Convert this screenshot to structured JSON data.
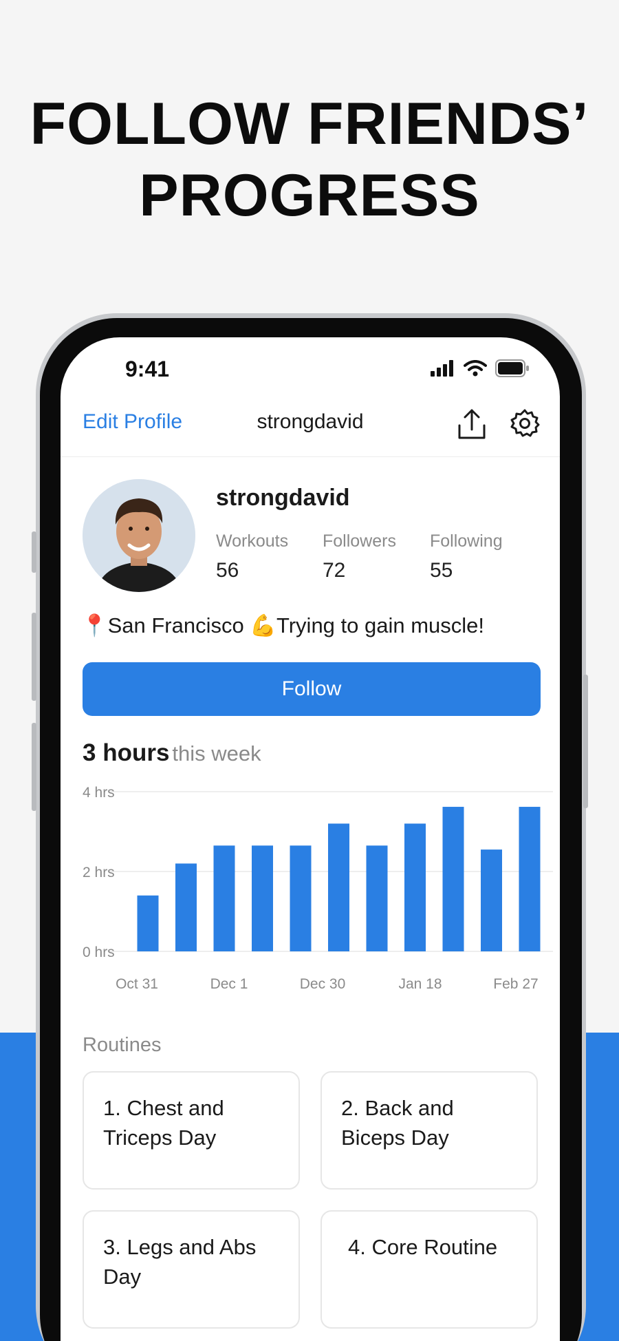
{
  "headline": {
    "line1": "FOLLOW FRIENDS’",
    "line2": "PROGRESS"
  },
  "status": {
    "time": "9:41"
  },
  "nav": {
    "edit_label": "Edit Profile",
    "title": "strongdavid"
  },
  "profile": {
    "name": "strongdavid",
    "stats": [
      {
        "label": "Workouts",
        "value": "56"
      },
      {
        "label": "Followers",
        "value": "72"
      },
      {
        "label": "Following",
        "value": "55"
      }
    ],
    "bio": "📍San Francisco 💪Trying to gain muscle!"
  },
  "follow_label": "Follow",
  "summary": {
    "amount": "3 hours",
    "period": "this week"
  },
  "colors": {
    "accent": "#2a7fe3",
    "background": "#f5f5f5"
  },
  "chart_data": {
    "type": "bar",
    "ylabel": "",
    "y_ticks": [
      "0 hrs",
      "2 hrs",
      "4 hrs"
    ],
    "ylim": [
      0,
      4
    ],
    "x_tick_labels": [
      "Oct 31",
      "Dec 1",
      "Dec 30",
      "Jan 18",
      "Feb 27"
    ],
    "values": [
      1.4,
      2.2,
      2.65,
      2.65,
      2.65,
      3.2,
      2.65,
      3.2,
      3.62,
      2.55,
      3.62
    ],
    "grid": true
  },
  "routines": {
    "label": "Routines",
    "items": [
      "1. Chest and Triceps Day",
      "2. Back and Biceps Day",
      "3. Legs and Abs Day",
      "4. Core Routine"
    ]
  }
}
